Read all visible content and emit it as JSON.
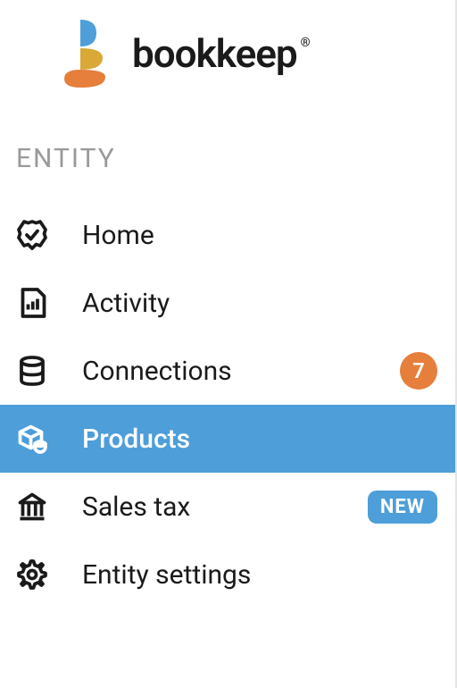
{
  "brand": {
    "name": "bookkeep",
    "registered": "®"
  },
  "sidebar": {
    "section_label": "ENTITY",
    "items": [
      {
        "label": "Home"
      },
      {
        "label": "Activity"
      },
      {
        "label": "Connections",
        "badge_count": "7"
      },
      {
        "label": "Products",
        "active": true
      },
      {
        "label": "Sales tax",
        "badge_new": "NEW"
      },
      {
        "label": "Entity settings"
      }
    ]
  }
}
